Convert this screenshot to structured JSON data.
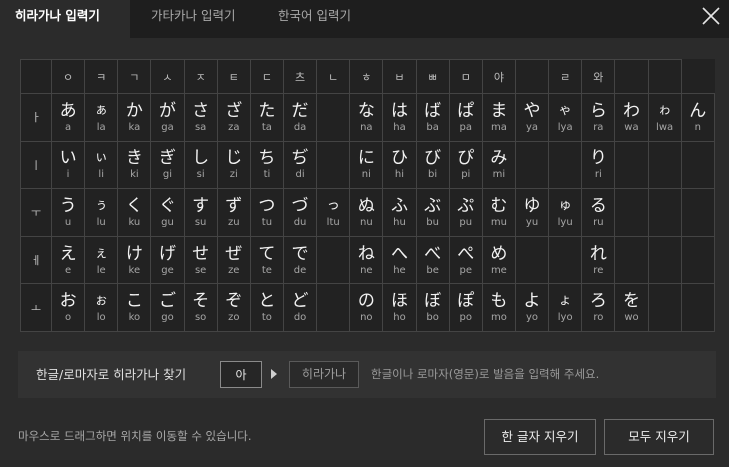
{
  "tabs": [
    {
      "label": "히라가나 입력기",
      "active": true
    },
    {
      "label": "가타카나 입력기",
      "active": false
    },
    {
      "label": "한국어 입력기",
      "active": false
    }
  ],
  "header_row": [
    "",
    "ㅇ",
    "ㅋ",
    "ㄱ",
    "ㅅ",
    "ㅈ",
    "ㅌ",
    "ㄷ",
    "츠",
    "ㄴ",
    "ㅎ",
    "ㅂ",
    "ㅃ",
    "ㅁ",
    "야",
    "",
    "ㄹ",
    "와",
    "",
    ""
  ],
  "rows": [
    {
      "vowel": "ㅏ",
      "cells": [
        {
          "k": "あ",
          "r": "a"
        },
        {
          "k": "ぁ",
          "r": "la",
          "small": true
        },
        {
          "k": "か",
          "r": "ka"
        },
        {
          "k": "が",
          "r": "ga"
        },
        {
          "k": "さ",
          "r": "sa"
        },
        {
          "k": "ざ",
          "r": "za"
        },
        {
          "k": "た",
          "r": "ta"
        },
        {
          "k": "だ",
          "r": "da"
        },
        null,
        {
          "k": "な",
          "r": "na"
        },
        {
          "k": "は",
          "r": "ha"
        },
        {
          "k": "ば",
          "r": "ba"
        },
        {
          "k": "ぱ",
          "r": "pa"
        },
        {
          "k": "ま",
          "r": "ma"
        },
        {
          "k": "や",
          "r": "ya"
        },
        {
          "k": "ゃ",
          "r": "lya",
          "small": true
        },
        {
          "k": "ら",
          "r": "ra"
        },
        {
          "k": "わ",
          "r": "wa"
        },
        {
          "k": "ゎ",
          "r": "lwa",
          "small": true
        },
        {
          "k": "ん",
          "r": "n"
        }
      ]
    },
    {
      "vowel": "ㅣ",
      "cells": [
        {
          "k": "い",
          "r": "i"
        },
        {
          "k": "ぃ",
          "r": "li",
          "small": true
        },
        {
          "k": "き",
          "r": "ki"
        },
        {
          "k": "ぎ",
          "r": "gi"
        },
        {
          "k": "し",
          "r": "si"
        },
        {
          "k": "じ",
          "r": "zi"
        },
        {
          "k": "ち",
          "r": "ti"
        },
        {
          "k": "ぢ",
          "r": "di"
        },
        null,
        {
          "k": "に",
          "r": "ni"
        },
        {
          "k": "ひ",
          "r": "hi"
        },
        {
          "k": "び",
          "r": "bi"
        },
        {
          "k": "ぴ",
          "r": "pi"
        },
        {
          "k": "み",
          "r": "mi"
        },
        null,
        null,
        {
          "k": "り",
          "r": "ri"
        },
        null,
        null,
        null
      ]
    },
    {
      "vowel": "ㅜ",
      "cells": [
        {
          "k": "う",
          "r": "u"
        },
        {
          "k": "ぅ",
          "r": "lu",
          "small": true
        },
        {
          "k": "く",
          "r": "ku"
        },
        {
          "k": "ぐ",
          "r": "gu"
        },
        {
          "k": "す",
          "r": "su"
        },
        {
          "k": "ず",
          "r": "zu"
        },
        {
          "k": "つ",
          "r": "tu"
        },
        {
          "k": "づ",
          "r": "du"
        },
        {
          "k": "っ",
          "r": "ltu",
          "small": true
        },
        {
          "k": "ぬ",
          "r": "nu"
        },
        {
          "k": "ふ",
          "r": "hu"
        },
        {
          "k": "ぶ",
          "r": "bu"
        },
        {
          "k": "ぷ",
          "r": "pu"
        },
        {
          "k": "む",
          "r": "mu"
        },
        {
          "k": "ゆ",
          "r": "yu"
        },
        {
          "k": "ゅ",
          "r": "lyu",
          "small": true
        },
        {
          "k": "る",
          "r": "ru"
        },
        null,
        null,
        null
      ]
    },
    {
      "vowel": "ㅔ",
      "cells": [
        {
          "k": "え",
          "r": "e"
        },
        {
          "k": "ぇ",
          "r": "le",
          "small": true
        },
        {
          "k": "け",
          "r": "ke"
        },
        {
          "k": "げ",
          "r": "ge"
        },
        {
          "k": "せ",
          "r": "se"
        },
        {
          "k": "ぜ",
          "r": "ze"
        },
        {
          "k": "て",
          "r": "te"
        },
        {
          "k": "で",
          "r": "de"
        },
        null,
        {
          "k": "ね",
          "r": "ne"
        },
        {
          "k": "へ",
          "r": "he"
        },
        {
          "k": "べ",
          "r": "be"
        },
        {
          "k": "ぺ",
          "r": "pe"
        },
        {
          "k": "め",
          "r": "me"
        },
        null,
        null,
        {
          "k": "れ",
          "r": "re"
        },
        null,
        null,
        null
      ]
    },
    {
      "vowel": "ㅗ",
      "cells": [
        {
          "k": "お",
          "r": "o"
        },
        {
          "k": "ぉ",
          "r": "lo",
          "small": true
        },
        {
          "k": "こ",
          "r": "ko"
        },
        {
          "k": "ご",
          "r": "go"
        },
        {
          "k": "そ",
          "r": "so"
        },
        {
          "k": "ぞ",
          "r": "zo"
        },
        {
          "k": "と",
          "r": "to"
        },
        {
          "k": "ど",
          "r": "do"
        },
        null,
        {
          "k": "の",
          "r": "no"
        },
        {
          "k": "ほ",
          "r": "ho"
        },
        {
          "k": "ぼ",
          "r": "bo"
        },
        {
          "k": "ぽ",
          "r": "po"
        },
        {
          "k": "も",
          "r": "mo"
        },
        {
          "k": "よ",
          "r": "yo"
        },
        {
          "k": "ょ",
          "r": "lyo",
          "small": true
        },
        {
          "k": "ろ",
          "r": "ro"
        },
        {
          "k": "を",
          "r": "wo"
        },
        null,
        null
      ]
    }
  ],
  "search": {
    "label": "한글/로마자로 히라가나 찾기",
    "input_value": "아",
    "result": "히라가나",
    "hint": "한글이나 로마자(영문)로 발음을 입력해 주세요."
  },
  "footer": {
    "drag_hint": "마우스로 드래그하면 위치를 이동할 수 있습니다.",
    "delete_one": "한 글자 지우기",
    "delete_all": "모두 지우기"
  },
  "icons": {
    "close": "close-icon",
    "arrow": "arrow-right-icon"
  }
}
